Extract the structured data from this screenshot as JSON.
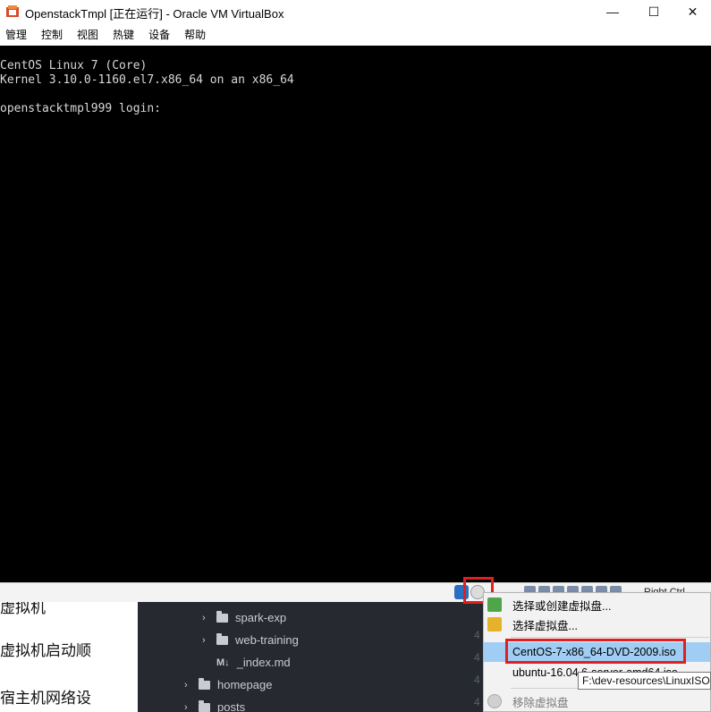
{
  "window": {
    "title": "OpenstackTmpl [正在运行] - Oracle VM VirtualBox",
    "minimize_glyph": "—",
    "maximize_glyph": "☐",
    "close_glyph": "✕"
  },
  "menubar": {
    "items": [
      "管理",
      "控制",
      "视图",
      "热键",
      "设备",
      "帮助"
    ]
  },
  "console": {
    "lines": [
      "CentOS Linux 7 (Core)",
      "Kernel 3.10.0-1160.el7.x86_64 on an x86_64",
      "openstacktmpl999 login:"
    ]
  },
  "statusbar": {
    "host_key": "Right Ctrl"
  },
  "background": {
    "left_lines": [
      "虚拟机",
      "虚拟机启动顺",
      "宿主机网络设"
    ],
    "tree": [
      {
        "label": "spark-exp",
        "type": "folder"
      },
      {
        "label": "web-training",
        "type": "folder"
      },
      {
        "label": "_index.md",
        "type": "markdown",
        "icon": "M↓"
      },
      {
        "label": "homepage",
        "type": "folder"
      },
      {
        "label": "posts",
        "type": "folder"
      }
    ],
    "gutter": [
      "4",
      "4",
      "4",
      "4",
      "4"
    ]
  },
  "optical_menu": {
    "items": [
      {
        "label": "选择或创建虚拟盘...",
        "icon": "create-disk-icon"
      },
      {
        "label": "选择虚拟盘...",
        "icon": "choose-disk-icon"
      },
      {
        "label": "CentOS-7-x86_64-DVD-2009.iso",
        "selected": true
      },
      {
        "label": "ubuntu-16.04.6-server-amd64.iso"
      },
      {
        "label": "移除虚拟盘",
        "icon": "remove-disk-icon",
        "disabled": true
      }
    ],
    "tooltip": "F:\\dev-resources\\LinuxISO"
  },
  "colors": {
    "highlight": "#e02020",
    "selection": "#9fcdf3",
    "console_bg": "#000000",
    "editor_bg": "#262a30"
  }
}
